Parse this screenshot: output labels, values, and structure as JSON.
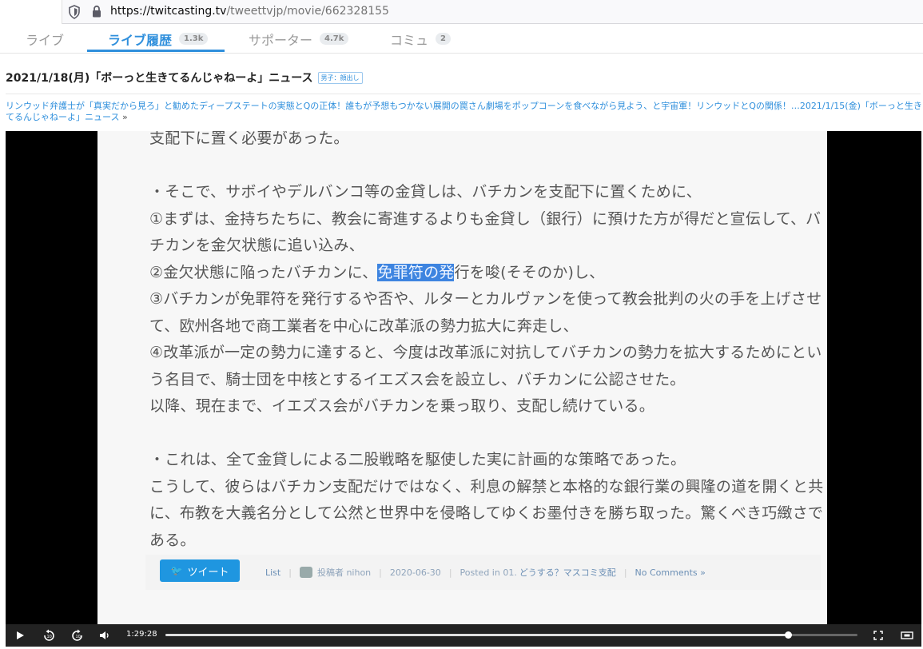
{
  "browser": {
    "url_host": "https://twitcasting.tv",
    "url_path": "/tweettvjp/movie/662328155"
  },
  "tabs": [
    {
      "label": "ライブ",
      "badge": ""
    },
    {
      "label": "ライブ履歴",
      "badge": "1.3k"
    },
    {
      "label": "サポーター",
      "badge": "4.7k"
    },
    {
      "label": "コミュ",
      "badge": "2"
    }
  ],
  "movie": {
    "title": "2021/1/18(月)「ボーっと生きてるんじゃねーよ」ニュース",
    "tag": "男子：顔出し"
  },
  "related_link": {
    "text": "リンウッド弁護士が「真実だから見ろ」と勧めたディープステートの実態とQの正体！誰もが予想もつかない展開の罠さん劇場をポップコーンを食べながら見よう、と宇宙軍！リンウッドとQの関係！…2021/1/15(金)「ボーっと生きてるんじゃねーよ」ニュース",
    "more": "»"
  },
  "slide": {
    "line1": "支配下に置く必要があった。",
    "line2": "・そこで、サボイやデルバンコ等の金貸しは、バチカンを支配下に置くために、",
    "line3": "①まずは、金持ちたちに、教会に寄進するよりも金貸し（銀行）に預けた方が得だと宣伝して、バ",
    "line4": "チカンを金欠状態に追い込み、",
    "line5_pre": "②金欠状態に陥ったバチカンに、",
    "line5_hl": "免罪符の発",
    "line5_post": "行を唆(そそのか)し、",
    "line6": "③バチカンが免罪符を発行するや否や、ルターとカルヴァンを使って教会批判の火の手を上げさせ",
    "line7": "て、欧州各地で商工業者を中心に改革派の勢力拡大に奔走し、",
    "line8": "④改革派が一定の勢力に達すると、今度は改革派に対抗してバチカンの勢力を拡大するためにとい",
    "line9": "う名目で、騎士団を中核とするイエズス会を設立し、バチカンに公認させた。",
    "line10": "以降、現在まで、イエズス会がバチカンを乗っ取り、支配し続けている。",
    "line11": "・これは、全て金貸しによる二股戦略を駆使した実に計画的な策略であった。",
    "line12": "こうして、彼らはバチカン支配だけではなく、利息の解禁と本格的な銀行業の興隆の道を開くと共",
    "line13": "に、布教を大義名分として公然と世界中を侵略してゆくお墨付きを勝ち取った。驚くべき巧緻さで",
    "line14": "ある。",
    "tweet_label": "ツイート",
    "list_label": "List",
    "poster": "投稿者 nihon",
    "date": "2020-06-30",
    "posted_in": "Posted in 01.",
    "category": "どうする？マスコミ支配",
    "comments": "No Comments »"
  },
  "player": {
    "time": "1:29:28",
    "progress": 0.9
  }
}
